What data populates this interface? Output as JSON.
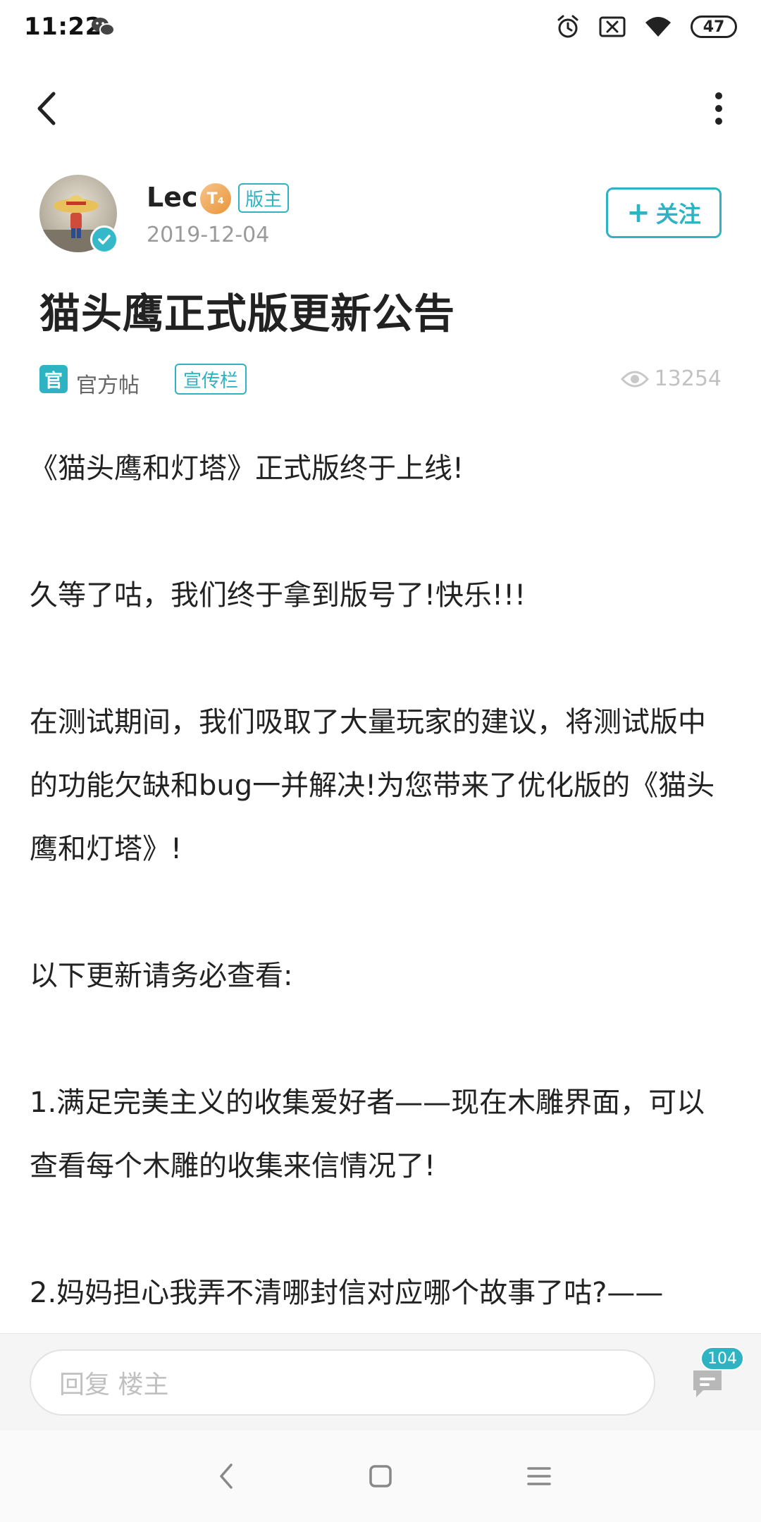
{
  "status_bar": {
    "time": "11:22",
    "battery": "47",
    "icons": [
      "wechat-icon",
      "alarm-icon",
      "sim-off-icon",
      "wifi-icon",
      "battery-icon"
    ]
  },
  "top_nav": {
    "back_icon": "chevron-left-icon",
    "more_icon": "vertical-dots-icon"
  },
  "author": {
    "name": "Lec",
    "level_badge": "T₄",
    "role_tag": "版主",
    "date": "2019-12-04",
    "follow_label": "关注"
  },
  "post": {
    "title": "猫头鹰正式版更新公告",
    "official_icon": "官",
    "official_label": "官方帖",
    "channel_tag": "宣传栏",
    "views": "13254",
    "body": [
      "《猫头鹰和灯塔》正式版终于上线!",
      "",
      "久等了咕，我们终于拿到版号了!快乐!!!",
      "",
      "在测试期间，我们吸取了大量玩家的建议，将测试版中的功能欠缺和bug一并解决!为您带来了优化版的《猫头鹰和灯塔》!",
      "",
      "以下更新请务必查看:",
      "",
      "1.满足完美主义的收集爱好者——现在木雕界面，可以查看每个木雕的收集来信情况了!",
      "",
      "2.妈妈担心我弄不清哪封信对应哪个故事了咕?——"
    ]
  },
  "reply_bar": {
    "placeholder": "回复  楼主",
    "comment_count": "104"
  },
  "colors": {
    "accent": "#2db3c2",
    "muted": "#9a9a9a",
    "text": "#222222"
  }
}
